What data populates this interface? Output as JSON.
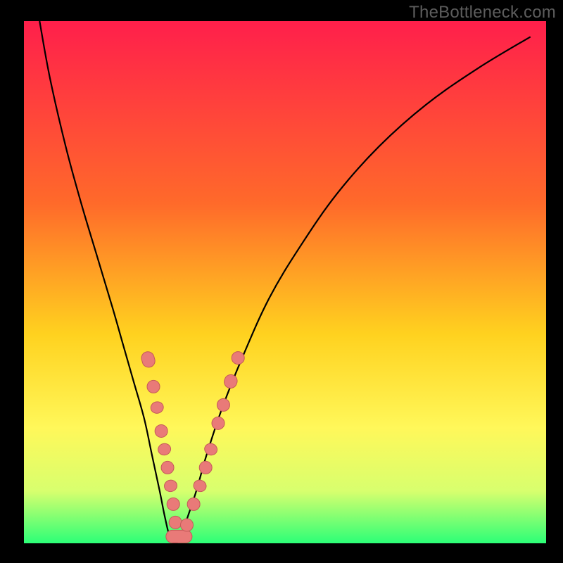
{
  "watermark": "TheBottleneck.com",
  "colors": {
    "grad_top": "#ff1f4b",
    "grad_mid1": "#ff6a2a",
    "grad_mid2": "#ffd21f",
    "grad_mid3": "#fff85a",
    "grad_bot1": "#d8ff6e",
    "grad_bot2": "#2cff77",
    "frame": "#000000",
    "curve": "#000000",
    "marker_fill": "#e97a78",
    "marker_stroke": "#c45a58"
  },
  "chart_data": {
    "type": "line",
    "title": "",
    "xlabel": "",
    "ylabel": "",
    "xlim": [
      0,
      100
    ],
    "ylim": [
      0,
      100
    ],
    "series": [
      {
        "name": "bottleneck-curve",
        "x": [
          3,
          5,
          8,
          11,
          14,
          17,
          19,
          21,
          23,
          24.5,
          26,
          27,
          28,
          29,
          30,
          31,
          33,
          35,
          38,
          42,
          47,
          53,
          60,
          68,
          77,
          87,
          97
        ],
        "values": [
          100,
          89,
          76,
          65,
          55,
          45,
          38,
          31,
          24,
          17,
          10,
          5,
          1,
          0,
          1,
          4,
          10,
          17,
          26,
          36,
          47,
          57,
          67,
          76,
          84,
          91,
          97
        ]
      }
    ],
    "markers": [
      {
        "x": 23.8,
        "y": 35.2,
        "shape": "pill",
        "len": 3
      },
      {
        "x": 24.8,
        "y": 30.0,
        "shape": "dot"
      },
      {
        "x": 25.5,
        "y": 26.0,
        "shape": "pill",
        "len": 2.2
      },
      {
        "x": 26.3,
        "y": 21.5,
        "shape": "dot"
      },
      {
        "x": 26.9,
        "y": 18.0,
        "shape": "pill",
        "len": 2.2
      },
      {
        "x": 27.5,
        "y": 14.5,
        "shape": "dot"
      },
      {
        "x": 28.1,
        "y": 11.0,
        "shape": "pill",
        "len": 2.2
      },
      {
        "x": 28.6,
        "y": 7.5,
        "shape": "dot"
      },
      {
        "x": 29.0,
        "y": 4.0,
        "shape": "dot"
      },
      {
        "x": 29.7,
        "y": 1.3,
        "shape": "pill-h",
        "len": 5
      },
      {
        "x": 31.2,
        "y": 3.5,
        "shape": "dot"
      },
      {
        "x": 32.5,
        "y": 7.5,
        "shape": "dot"
      },
      {
        "x": 33.7,
        "y": 11.0,
        "shape": "pill",
        "len": 2.2
      },
      {
        "x": 34.8,
        "y": 14.5,
        "shape": "dot"
      },
      {
        "x": 35.8,
        "y": 18.0,
        "shape": "pill",
        "len": 2.2
      },
      {
        "x": 37.2,
        "y": 23.0,
        "shape": "dot"
      },
      {
        "x": 38.2,
        "y": 26.5,
        "shape": "dot"
      },
      {
        "x": 39.6,
        "y": 31.0,
        "shape": "pill",
        "len": 2.6
      },
      {
        "x": 41.0,
        "y": 35.5,
        "shape": "dot"
      }
    ]
  }
}
